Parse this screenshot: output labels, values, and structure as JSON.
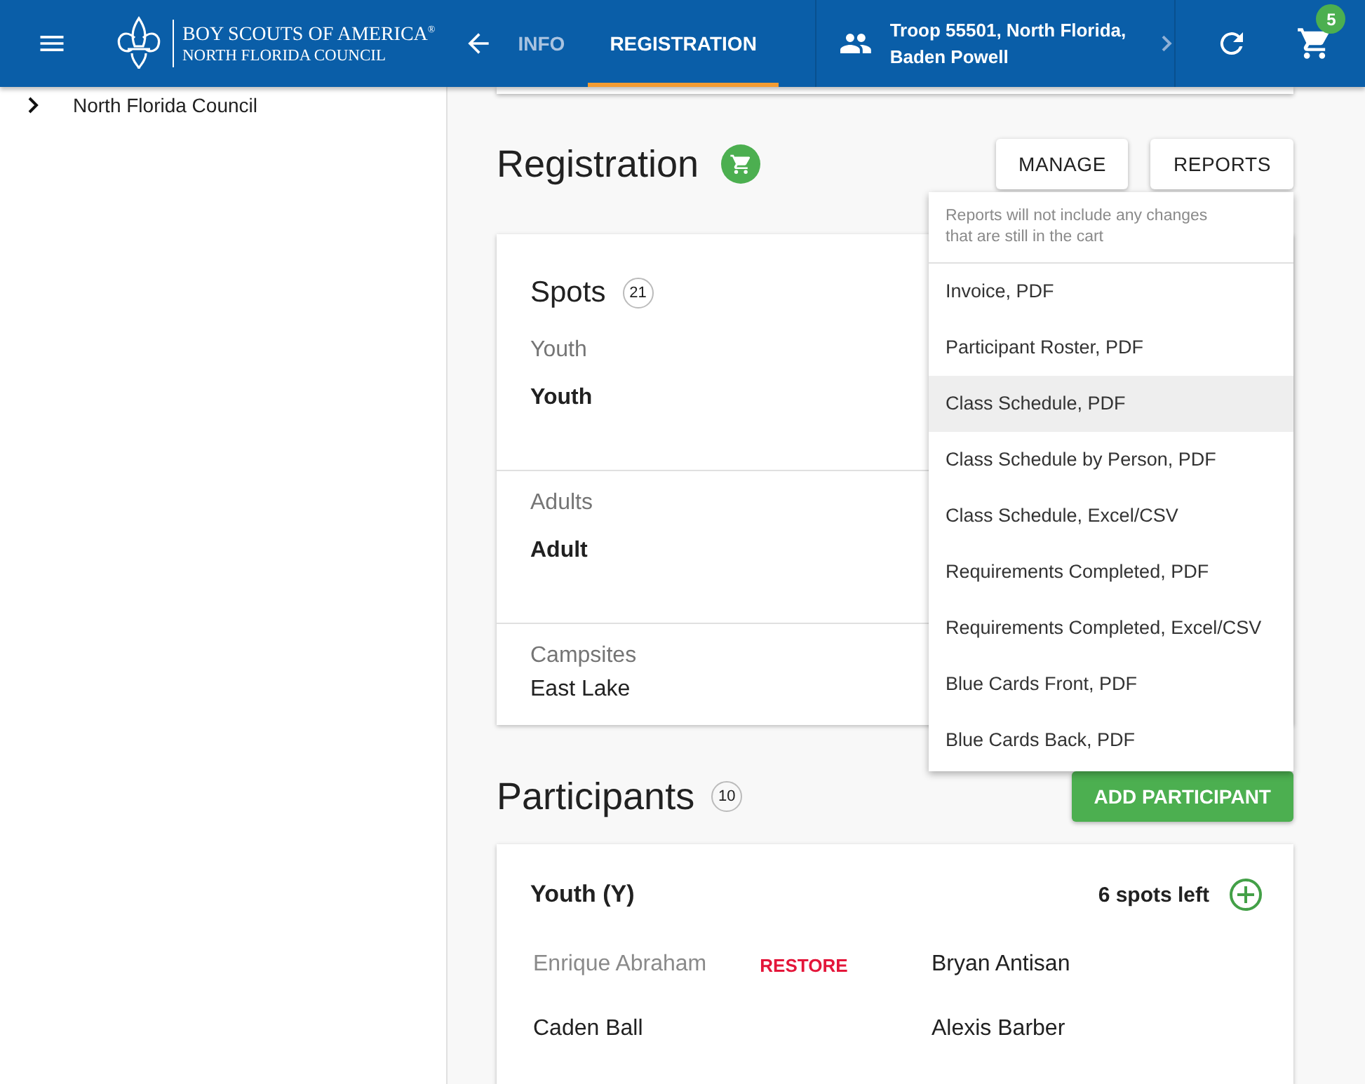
{
  "header": {
    "org_name": "BOY SCOUTS OF AMERICA",
    "org_mark": "®",
    "council": "NORTH FLORIDA COUNCIL",
    "tabs": [
      {
        "label": "INFO",
        "selected": false
      },
      {
        "label": "REGISTRATION",
        "selected": true
      }
    ],
    "unit": {
      "line_1": "Troop 55501, North Florida,",
      "line_2": "Baden Powell"
    },
    "cart_count": "5"
  },
  "sidebar": {
    "items": [
      {
        "label": "North Florida Council"
      }
    ]
  },
  "registration": {
    "title": "Registration",
    "buttons": [
      "MANAGE",
      "REPORTS"
    ],
    "reports_menu": {
      "note": "Reports will not include any changes that are still in the cart",
      "items": [
        {
          "label": "Invoice, PDF",
          "highlighted": false
        },
        {
          "label": "Participant Roster, PDF",
          "highlighted": false
        },
        {
          "label": "Class Schedule, PDF",
          "highlighted": true
        },
        {
          "label": "Class Schedule by Person, PDF",
          "highlighted": false
        },
        {
          "label": "Class Schedule, Excel/CSV",
          "highlighted": false
        },
        {
          "label": "Requirements Completed, PDF",
          "highlighted": false
        },
        {
          "label": "Requirements Completed, Excel/CSV",
          "highlighted": false
        },
        {
          "label": "Blue Cards Front, PDF",
          "highlighted": false
        },
        {
          "label": "Blue Cards Back, PDF",
          "highlighted": false
        }
      ]
    },
    "spots": {
      "title": "Spots",
      "count": "21",
      "sections": [
        {
          "label": "Youth",
          "value": "Youth",
          "kind": "type"
        },
        {
          "label": "Adults",
          "value": "Adult",
          "kind": "type"
        },
        {
          "label": "Campsites",
          "value": "East Lake",
          "kind": "plain"
        }
      ]
    }
  },
  "participants": {
    "title": "Participants",
    "count": "10",
    "add_button": "ADD PARTICIPANT",
    "groups": [
      {
        "title": "Youth (Y)",
        "spots_left": "6 spots left",
        "people": [
          {
            "name": "Enrique Abraham",
            "removed": true,
            "action": "RESTORE"
          },
          {
            "name": "Bryan Antisan",
            "removed": false
          },
          {
            "name": "Caden Ball",
            "removed": false
          },
          {
            "name": "Alexis Barber",
            "removed": false
          }
        ]
      }
    ]
  }
}
